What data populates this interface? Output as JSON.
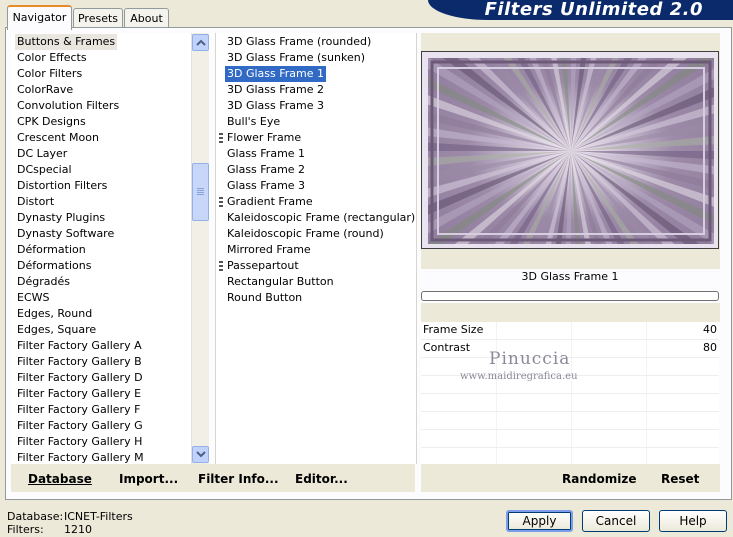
{
  "window": {
    "title": "Filters Unlimited 2.0"
  },
  "tabs": [
    {
      "label": "Navigator",
      "active": true
    },
    {
      "label": "Presets",
      "active": false
    },
    {
      "label": "About",
      "active": false
    }
  ],
  "categories": {
    "selected": "Buttons & Frames",
    "items": [
      "Buttons & Frames",
      "Color Effects",
      "Color Filters",
      "ColorRave",
      "Convolution Filters",
      "CPK Designs",
      "Crescent Moon",
      "DC Layer",
      "DCspecial",
      "Distortion Filters",
      "Distort",
      "Dynasty Plugins",
      "Dynasty Software",
      "Déformation",
      "Déformations",
      "Dégradés",
      "ECWS",
      "Edges, Round",
      "Edges, Square",
      "Filter Factory Gallery A",
      "Filter Factory Gallery B",
      "Filter Factory Gallery D",
      "Filter Factory Gallery E",
      "Filter Factory Gallery F",
      "Filter Factory Gallery G",
      "Filter Factory Gallery H",
      "Filter Factory Gallery M"
    ]
  },
  "filters": {
    "selected": "3D Glass Frame 1",
    "items": [
      {
        "label": "3D Glass Frame (rounded)",
        "grip": false
      },
      {
        "label": "3D Glass Frame (sunken)",
        "grip": false
      },
      {
        "label": "3D Glass Frame 1",
        "grip": false
      },
      {
        "label": "3D Glass Frame 2",
        "grip": false
      },
      {
        "label": "3D Glass Frame 3",
        "grip": false
      },
      {
        "label": "Bull's Eye",
        "grip": false
      },
      {
        "label": "Flower Frame",
        "grip": true
      },
      {
        "label": "Glass Frame 1",
        "grip": false
      },
      {
        "label": "Glass Frame 2",
        "grip": false
      },
      {
        "label": "Glass Frame 3",
        "grip": false
      },
      {
        "label": "Gradient Frame",
        "grip": true
      },
      {
        "label": "Kaleidoscopic Frame (rectangular)",
        "grip": false
      },
      {
        "label": "Kaleidoscopic Frame (round)",
        "grip": false
      },
      {
        "label": "Mirrored Frame",
        "grip": false
      },
      {
        "label": "Passepartout",
        "grip": true
      },
      {
        "label": "Rectangular Button",
        "grip": false
      },
      {
        "label": "Round Button",
        "grip": false
      }
    ]
  },
  "list_buttons": {
    "database": "Database",
    "import": "Import...",
    "filter_info": "Filter Info...",
    "editor": "Editor..."
  },
  "preview": {
    "filter_name": "3D Glass Frame 1",
    "progress": 0,
    "watermark_name": "Pinuccia",
    "watermark_url": "www.maidiregrafica.eu"
  },
  "parameters": [
    {
      "label": "Frame Size",
      "value": "40"
    },
    {
      "label": "Contrast",
      "value": "80"
    }
  ],
  "preview_buttons": {
    "randomize": "Randomize",
    "reset": "Reset"
  },
  "status": {
    "database_label": "Database:",
    "database_value": "ICNET-Filters",
    "filters_label": "Filters:",
    "filters_value": "1210"
  },
  "dialog_buttons": {
    "apply": "Apply",
    "cancel": "Cancel",
    "help": "Help"
  },
  "colors": {
    "accent": "#316ac5",
    "banner": "#0a2a6c",
    "tab_highlight": "#e68b2c"
  }
}
